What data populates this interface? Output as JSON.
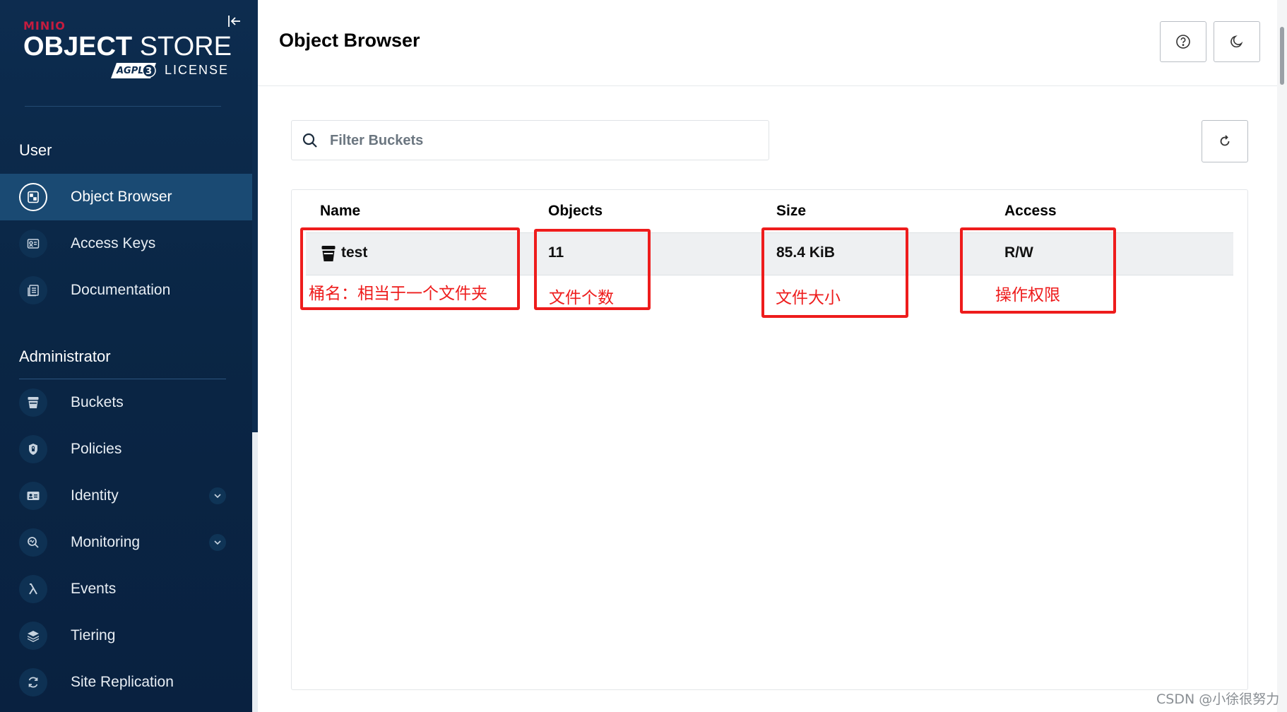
{
  "brand": {
    "minio": "MINIO",
    "title_bold": "OBJECT",
    "title_light": " STORE",
    "agpl": "AGPLv3",
    "license": "LICENSE"
  },
  "sidebar": {
    "user_section": "User",
    "admin_section": "Administrator",
    "user_items": [
      {
        "label": "Object Browser",
        "icon": "object-browser-icon",
        "active": true
      },
      {
        "label": "Access Keys",
        "icon": "access-keys-icon"
      },
      {
        "label": "Documentation",
        "icon": "documentation-icon"
      }
    ],
    "admin_items": [
      {
        "label": "Buckets",
        "icon": "bucket-icon"
      },
      {
        "label": "Policies",
        "icon": "policy-shield-icon"
      },
      {
        "label": "Identity",
        "icon": "identity-card-icon",
        "expandable": true
      },
      {
        "label": "Monitoring",
        "icon": "monitoring-icon",
        "expandable": true
      },
      {
        "label": "Events",
        "icon": "lambda-icon"
      },
      {
        "label": "Tiering",
        "icon": "tiering-layers-icon"
      },
      {
        "label": "Site Replication",
        "icon": "site-replication-icon"
      }
    ]
  },
  "header": {
    "title": "Object Browser",
    "help_icon": "help-icon",
    "theme_icon": "dark-mode-icon"
  },
  "search": {
    "placeholder": "Filter Buckets",
    "value": ""
  },
  "table": {
    "columns": [
      "Name",
      "Objects",
      "Size",
      "Access"
    ],
    "rows": [
      {
        "name": "test",
        "objects": "11",
        "size": "85.4 KiB",
        "access": "R/W"
      }
    ]
  },
  "annotations": {
    "name": "桶名：相当于一个文件夹",
    "objects": "文件个数",
    "size": "文件大小",
    "access": "操作权限",
    "color": "#ee1c1c"
  },
  "watermark": "CSDN @小徐很努力",
  "colors": {
    "sidebar_bg": "#0d2c4f",
    "active_item": "#1a4a73",
    "brand_red": "#c51c3f"
  }
}
